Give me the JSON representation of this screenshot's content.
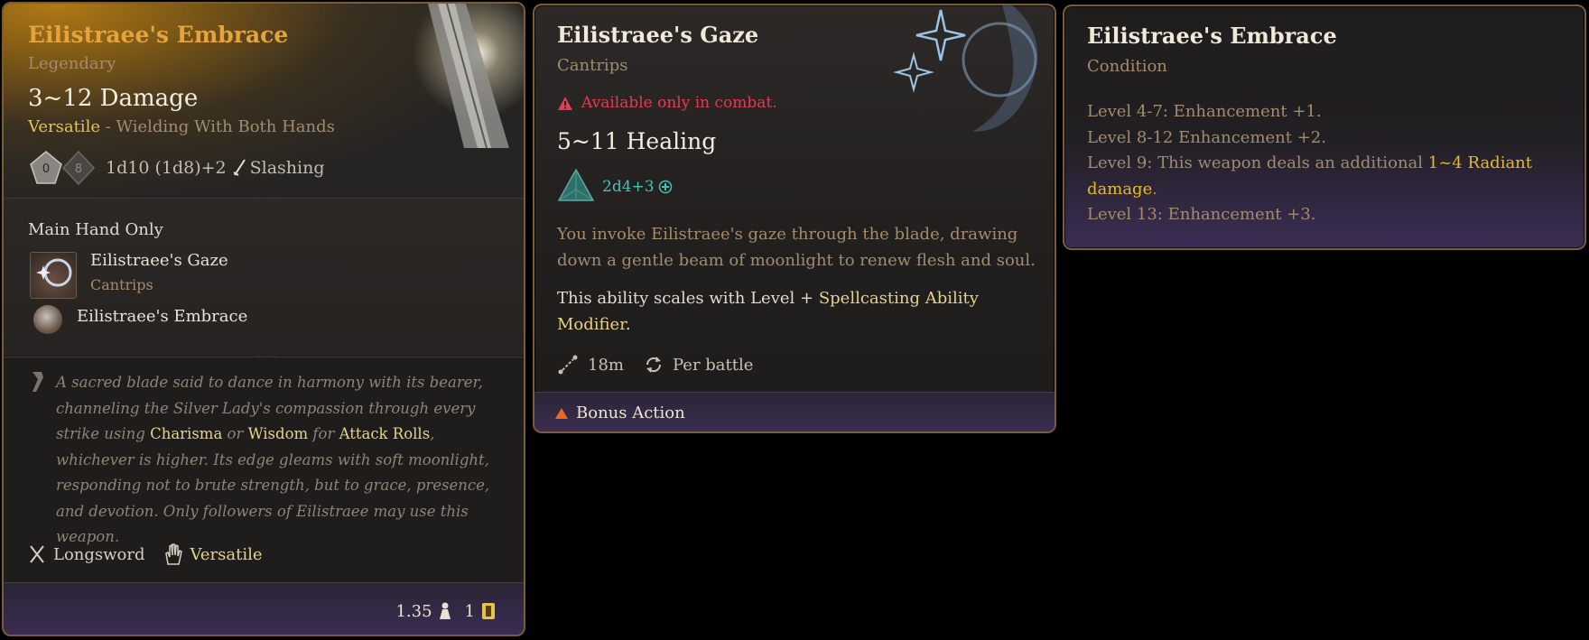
{
  "weapon_tooltip": {
    "title": "Eilistraee's Embrace",
    "rarity": "Legendary",
    "damage": "3~12 Damage",
    "versatile_label": "Versatile",
    "versatile_detail": " - Wielding With Both Hands",
    "dice_a": "0",
    "dice_b": "8",
    "damage_formula": "1d10 (1d8)+2",
    "damage_type": "Slashing",
    "section_title": "Main Hand Only",
    "spell_name": "Eilistraee's Gaze",
    "spell_type": "Cantrips",
    "condition_name": "Eilistraee's Embrace",
    "lore_1": "A sacred blade said to dance in harmony with its bearer, channeling the Silver Lady's compassion through every strike using ",
    "lore_hl1": "Charisma",
    "lore_2": " or ",
    "lore_hl2": "Wisdom",
    "lore_3": " for ",
    "lore_hl3": "Attack Rolls",
    "lore_4": ", whichever is higher. Its edge gleams with soft moonlight, responding not to brute strength, but to grace, presence, and devotion. Only followers of Eilistraee may use this weapon.",
    "proficiency": "Longsword",
    "property": "Versatile",
    "weight": "1.35",
    "value": "1",
    "accent_color": "#e3a43b",
    "icons": [
      "d10-dice-icon",
      "d8-dice-icon",
      "sword-icon",
      "quote-icon",
      "longsword-icon",
      "hand-icon",
      "weight-icon",
      "gold-icon"
    ]
  },
  "spell_tooltip": {
    "title": "Eilistraee's Gaze",
    "type": "Cantrips",
    "warning": "Available only in combat.",
    "healing": "5~11 Healing",
    "dice_formula": "2d4+3",
    "description": "You invoke Eilistraee's gaze through the blade, drawing down a gentle beam of moonlight to renew flesh and soul.",
    "scale_prefix": "This ability scales with Level + ",
    "scale_highlight": "Spellcasting Ability Modifier",
    "scale_suffix": ".",
    "range": "18m",
    "recharge": "Per battle",
    "action_type": "Bonus Action",
    "warning_color": "#e23b52",
    "icons": [
      "warning-icon",
      "d4-dice-icon",
      "heal-plus-icon",
      "range-icon",
      "recharge-icon",
      "bonus-action-icon",
      "starburst-icon"
    ]
  },
  "condition_tooltip": {
    "title": "Eilistraee's Embrace",
    "type": "Condition",
    "line1": "Level 4-7: Enhancement +1.",
    "line2": "Level 8-12 Enhancement +2.",
    "line3_prefix": "Level 9: This weapon deals an additional ",
    "line3_highlight": "1~4 Radiant damage",
    "line3_suffix": ".",
    "line4": "Level 13: Enhancement +3."
  }
}
